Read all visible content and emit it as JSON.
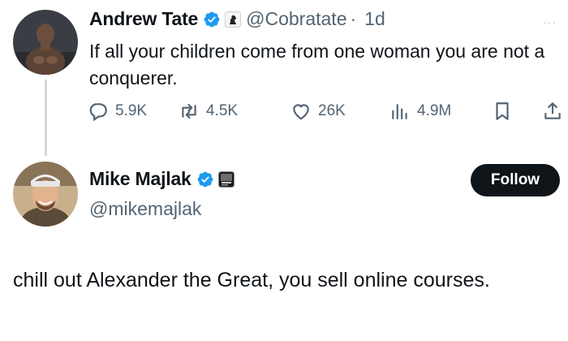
{
  "original_tweet": {
    "author_name": "Andrew Tate",
    "handle": "@Cobratate",
    "separator": "·",
    "time": "1d",
    "text": "If all your children come from one woman you are not a conquerer.",
    "more_label": "···",
    "avatar": "avatar-photo",
    "affiliation_badge": "chess-knight-badge-icon",
    "actions": {
      "replies": "5.9K",
      "retweets": "4.5K",
      "likes": "26K",
      "views": "4.9M"
    }
  },
  "reply_tweet": {
    "author_name": "Mike Majlak",
    "handle": "@mikemajlak",
    "avatar": "avatar-photo",
    "affiliation_badge": "podcast-badge-icon",
    "follow_label": "Follow",
    "text": "chill out Alexander the Great, you sell online courses."
  },
  "colors": {
    "verified_blue": "#1d9bf0",
    "text_primary": "#0f1419",
    "text_secondary": "#536471",
    "thread_line": "#cfd9de",
    "follow_bg": "#0f1419"
  }
}
